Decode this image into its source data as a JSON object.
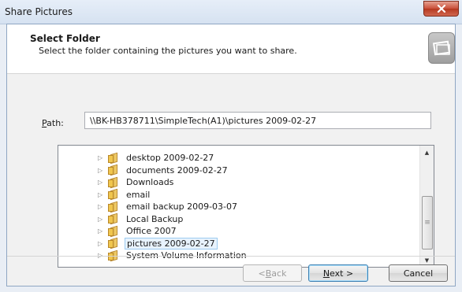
{
  "window": {
    "title": "Share Pictures"
  },
  "header": {
    "title": "Select Folder",
    "subtitle": "Select the folder containing the pictures you want to share."
  },
  "path": {
    "label_accel": "P",
    "label_rest": "ath:",
    "value": "\\\\BK-HB378711\\SimpleTech(A1)\\pictures 2009-02-27"
  },
  "tree": {
    "items": [
      {
        "label": "desktop 2009-02-27"
      },
      {
        "label": "documents 2009-02-27"
      },
      {
        "label": "Downloads"
      },
      {
        "label": "email"
      },
      {
        "label": "email backup 2009-03-07"
      },
      {
        "label": "Local Backup"
      },
      {
        "label": "Office 2007"
      },
      {
        "label": "pictures 2009-02-27"
      },
      {
        "label": "System Volume Information"
      }
    ],
    "selected_index": 7
  },
  "buttons": {
    "back": {
      "pre": "< ",
      "accel": "B",
      "post": "ack"
    },
    "next": {
      "accel": "N",
      "post": "ext >"
    },
    "cancel": {
      "label": "Cancel"
    }
  },
  "icons": {
    "close": "close-icon",
    "folder": "folder-icon",
    "expander": "triangle-right-icon"
  },
  "colors": {
    "selection_bg": "#e8f3fd",
    "selection_border": "#9ccbf0",
    "close_button": "#c9503a"
  }
}
